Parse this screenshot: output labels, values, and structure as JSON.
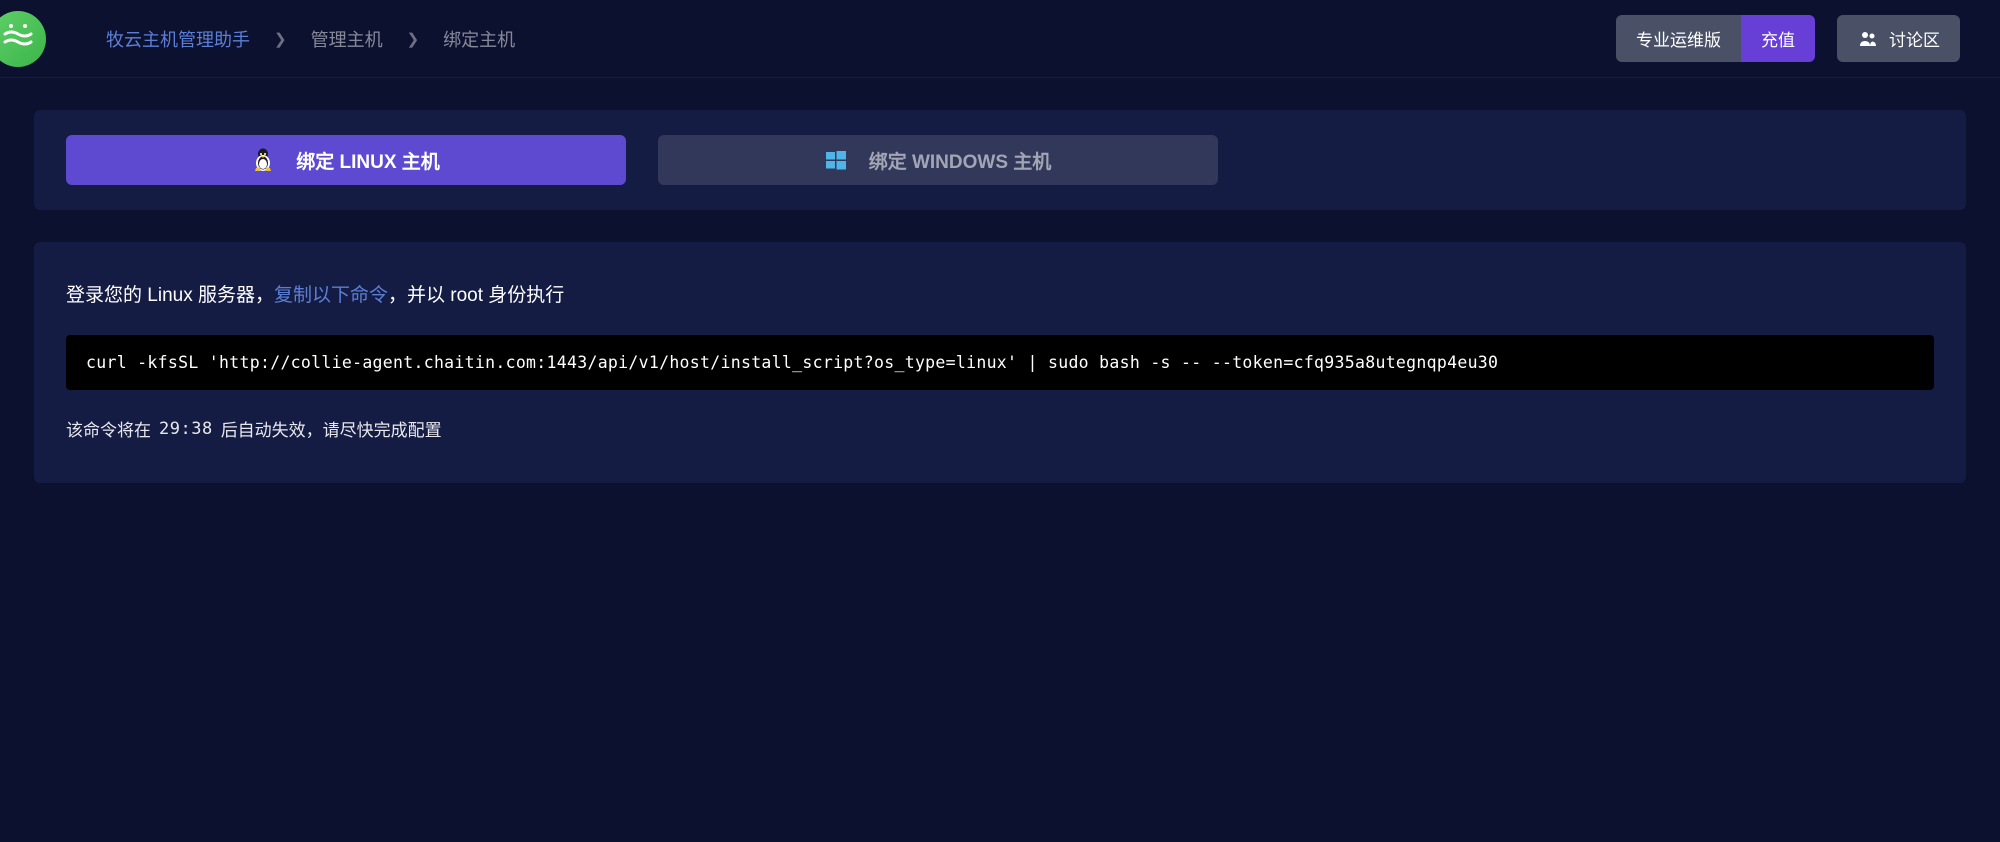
{
  "header": {
    "breadcrumb": {
      "home": "牧云主机管理助手",
      "manage": "管理主机",
      "bind": "绑定主机"
    },
    "buttons": {
      "pro_ops": "专业运维版",
      "recharge": "充值",
      "forum": "讨论区"
    }
  },
  "tabs": {
    "linux": "绑定 LINUX 主机",
    "windows": "绑定 WINDOWS 主机"
  },
  "instruction": {
    "prefix": "登录您的 Linux 服务器，",
    "copy_link": "复制以下命令",
    "suffix": "，并以 root 身份执行"
  },
  "command": "curl -kfsSL 'http://collie-agent.chaitin.com:1443/api/v1/host/install_script?os_type=linux' | sudo bash -s -- --token=cfq935a8utegnqp4eu30",
  "expiry": {
    "prefix": "该命令将在",
    "countdown": "29:38",
    "suffix": "后自动失效，请尽快完成配置"
  }
}
